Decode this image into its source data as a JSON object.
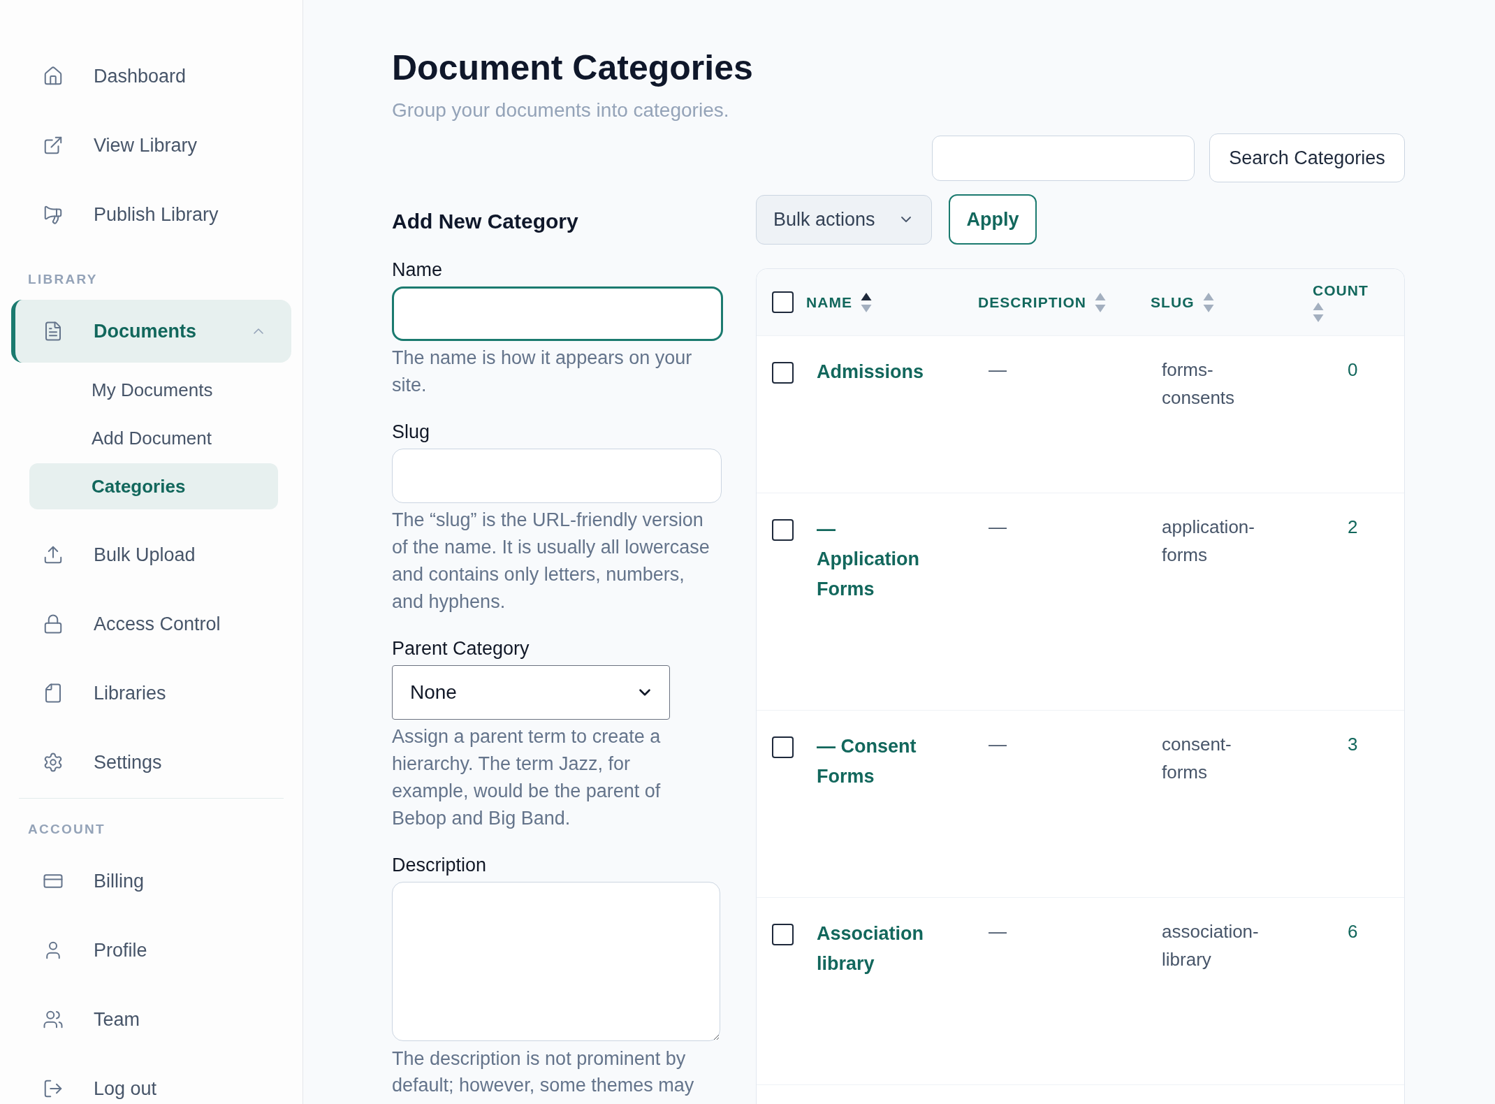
{
  "sidebar": {
    "groups": [
      {
        "divider_above": false,
        "items": [
          {
            "label": "Dashboard",
            "selected": false
          },
          {
            "label": "View Library",
            "selected": false
          },
          {
            "label": "Publish Library",
            "selected": false
          }
        ]
      },
      {
        "divider_above": false,
        "label": "LIBRARY",
        "items": [
          {
            "label": "Documents",
            "selected": true,
            "expanded": true,
            "children": [
              {
                "label": "My Documents",
                "selected": false
              },
              {
                "label": "Add Document",
                "selected": false
              },
              {
                "label": "Categories",
                "selected": true
              }
            ]
          },
          {
            "label": "Bulk Upload",
            "selected": false
          },
          {
            "label": "Access Control",
            "selected": false
          },
          {
            "label": "Libraries",
            "selected": false
          },
          {
            "label": "Settings",
            "selected": false
          }
        ]
      },
      {
        "divider_above": true,
        "label": "ACCOUNT",
        "items": [
          {
            "label": "Billing",
            "selected": false
          },
          {
            "label": "Profile",
            "selected": false
          },
          {
            "label": "Team",
            "selected": false
          },
          {
            "label": "Log out",
            "selected": false
          }
        ]
      }
    ]
  },
  "page": {
    "title": "Document Categories",
    "subtitle": "Group your documents into categories."
  },
  "search": {
    "button": "Search Categories"
  },
  "form": {
    "title": "Add New Category",
    "fields": [
      {
        "kind": "text",
        "label": "Name",
        "focused": true,
        "help": "The name is how it appears on your site."
      },
      {
        "kind": "text",
        "label": "Slug",
        "focused": false,
        "help": "The “slug” is the URL-friendly version of the name. It is usually all lowercase and contains only letters, numbers, and hyphens."
      },
      {
        "kind": "select",
        "label": "Parent Category",
        "value": "None",
        "help": "Assign a parent term to create a hierarchy. The term Jazz, for example, would be the parent of Bebop and Big Band."
      },
      {
        "kind": "textarea",
        "label": "Description",
        "help": "The description is not prominent by default; however, some themes may"
      }
    ]
  },
  "bulk_actions": {
    "value": "Bulk actions",
    "apply_button": "Apply"
  },
  "table": {
    "select_all_checked": false,
    "columns": [
      {
        "label": "NAME",
        "sorted": true
      },
      {
        "label": "DESCRIPTION",
        "sorted": false
      },
      {
        "label": "SLUG",
        "sorted": false
      },
      {
        "label": "COUNT",
        "sorted": false
      }
    ],
    "rows": [
      {
        "checked": false,
        "name": "Admissions",
        "description": "—",
        "slug": "forms-consents",
        "count": "0"
      },
      {
        "checked": false,
        "name": "— Application Forms",
        "description": "—",
        "slug": "application-forms",
        "count": "2"
      },
      {
        "checked": false,
        "name": "— Consent Forms",
        "description": "—",
        "slug": "consent-forms",
        "count": "3"
      },
      {
        "checked": false,
        "name": "Association library",
        "description": "—",
        "slug": "association-library",
        "count": "6"
      }
    ]
  }
}
